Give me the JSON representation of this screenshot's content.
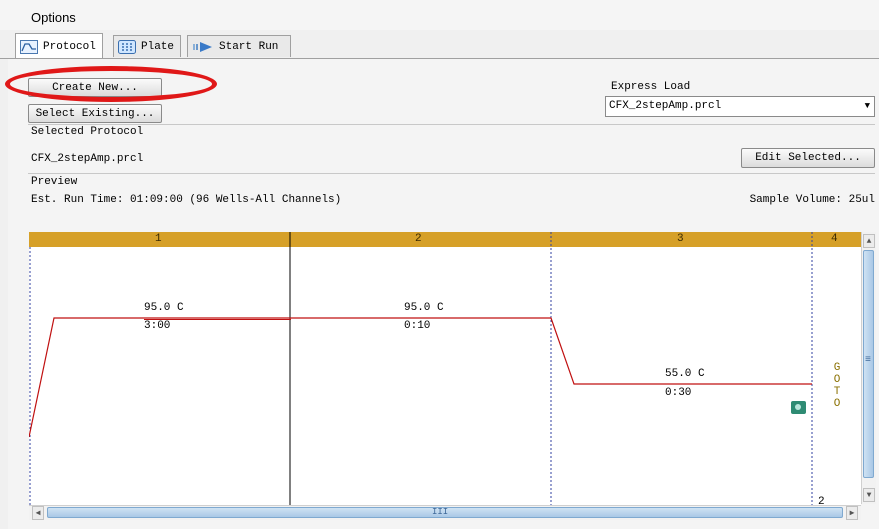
{
  "menu": {
    "options_label": "Options"
  },
  "tabs": [
    {
      "label": "Protocol",
      "icon": "protocol-graph-icon",
      "active": true
    },
    {
      "label": "Plate",
      "icon": "plate-grid-icon",
      "active": false
    },
    {
      "label": "Start Run",
      "icon": "start-run-arrow-icon",
      "active": false
    }
  ],
  "protocol": {
    "create_new_label": "Create New...",
    "select_existing_label": "Select Existing...",
    "express_load_label": "Express Load",
    "express_load_value": "CFX_2stepAmp.prcl",
    "selected_protocol_label": "Selected Protocol",
    "selected_protocol_value": "CFX_2stepAmp.prcl",
    "edit_selected_label": "Edit Selected...",
    "preview_label": "Preview",
    "est_run_time": "Est. Run Time: 01:09:00  (96 Wells-All Channels)",
    "sample_volume": "Sample Volume: 25ul"
  },
  "graph": {
    "steps": [
      "1",
      "2",
      "3",
      "4"
    ],
    "step1": {
      "temp": "95.0  C",
      "time": "3:00"
    },
    "step2": {
      "temp": "95.0  C",
      "time": "0:10"
    },
    "step3": {
      "temp": "55.0  C",
      "time": "0:30"
    },
    "goto_letters": [
      "G",
      "O",
      "T",
      "O"
    ],
    "goto_target": "2",
    "hscroll_grip": "III",
    "vscroll_grip": "≡"
  },
  "colors": {
    "header_bar": "#d6a028",
    "temp_line": "#c01010",
    "annotation_ellipse": "#e01818"
  }
}
